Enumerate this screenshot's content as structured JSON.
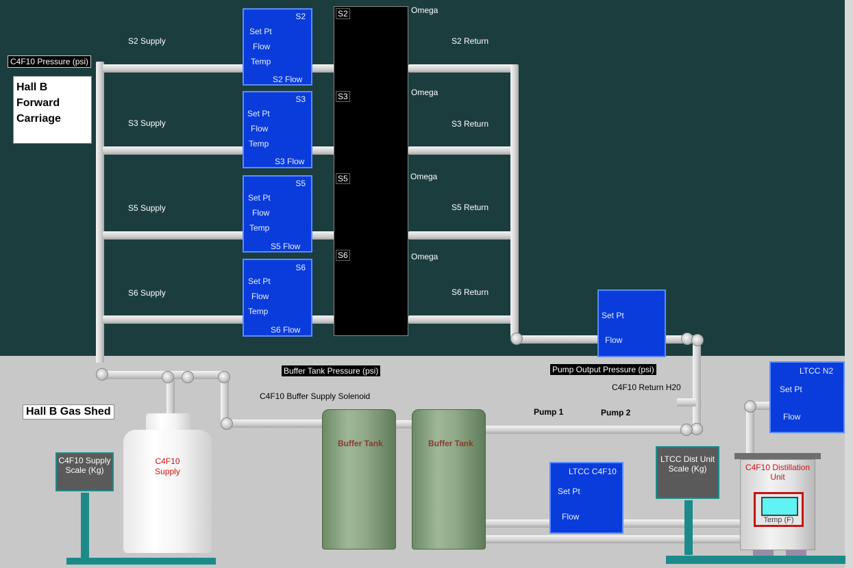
{
  "hall_b_label": [
    "Hall B",
    "Forward",
    "Carriage"
  ],
  "gas_shed_label": "Hall B Gas Shed",
  "c4f10_pressure": "C4F10 Pressure (psi)",
  "buffer_tank_pressure": "Buffer Tank Pressure (psi)",
  "pump_output_pressure": "Pump Output Pressure (psi)",
  "sectors": [
    {
      "id": "S2",
      "supply": "S2 Supply",
      "return": "S2 Return",
      "flow": "S2 Flow",
      "omega": "Omega"
    },
    {
      "id": "S3",
      "supply": "S3 Supply",
      "return": "S3 Return",
      "flow": "S3 Flow",
      "omega": "Omega"
    },
    {
      "id": "S5",
      "supply": "S5 Supply",
      "return": "S5 Return",
      "flow": "S5 Flow",
      "omega": "Omega"
    },
    {
      "id": "S6",
      "supply": "S6 Supply",
      "return": "S6 Return",
      "flow": "S6 Flow",
      "omega": "Omega"
    }
  ],
  "controller_fields": {
    "set_pt": "Set Pt",
    "flow": "Flow",
    "temp": "Temp"
  },
  "solenoid_label": "C4F10 Buffer Supply Solenoid",
  "return_h2o": "C4F10 Return H20",
  "pump1": "Pump 1",
  "pump2": "Pump 2",
  "buffer_tank": "Buffer Tank",
  "supply_tank": [
    "C4F10",
    "Supply"
  ],
  "supply_scale": [
    "C4F10 Supply",
    "Scale (Kg)"
  ],
  "dist_scale": [
    "LTCC Dist Unit",
    "Scale (Kg)"
  ],
  "ltcc_c4f10": {
    "title": "LTCC C4F10",
    "set_pt": "Set Pt",
    "flow": "Flow"
  },
  "ltcc_n2": {
    "title": "LTCC N2",
    "set_pt": "Set Pt",
    "flow": "Flow"
  },
  "pump_ctrl": {
    "set_pt": "Set Pt",
    "flow": "Flow"
  },
  "distillation": {
    "title": [
      "C4F10 Distillation",
      "Unit"
    ],
    "temp": "Temp (F)"
  },
  "colors": {
    "panel": "#1b3d3d",
    "controller_blue": "#0a3cdc",
    "scale_teal": "#1d8a8a",
    "tank_green": "#8fa886"
  }
}
